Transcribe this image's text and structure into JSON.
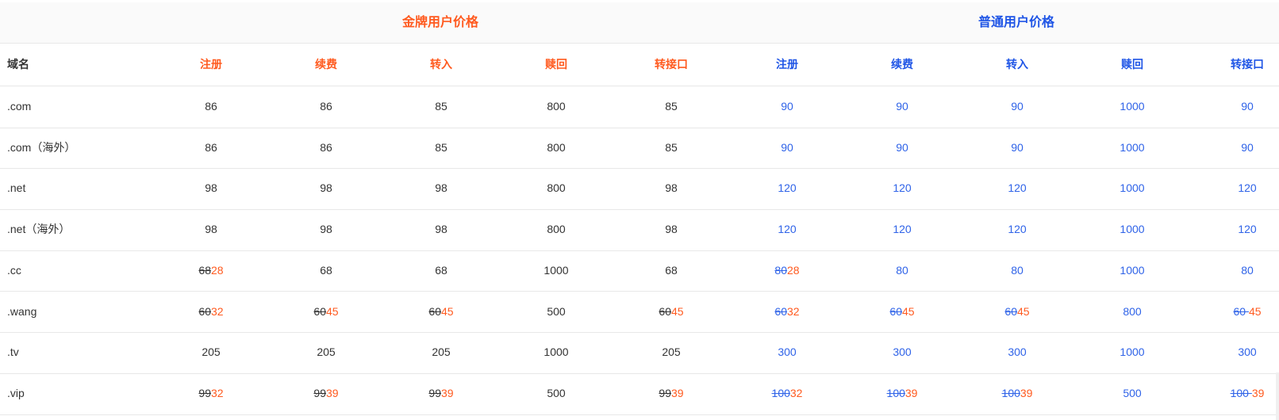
{
  "headers": {
    "gold_group": "金牌用户价格",
    "normal_group": "普通用户价格",
    "domain": "域名",
    "gold": [
      "注册",
      "续费",
      "转入",
      "赎回",
      "转接口"
    ],
    "normal": [
      "注册",
      "续费",
      "转入",
      "赎回",
      "转接口"
    ]
  },
  "rows": [
    {
      "domain": ".com",
      "gold": [
        {
          "value": "86"
        },
        {
          "value": "86"
        },
        {
          "value": "85"
        },
        {
          "value": "800"
        },
        {
          "value": "85"
        }
      ],
      "normal": [
        {
          "value": "90"
        },
        {
          "value": "90"
        },
        {
          "value": "90"
        },
        {
          "value": "1000"
        },
        {
          "value": "90"
        }
      ]
    },
    {
      "domain": ".com（海外）",
      "gold": [
        {
          "value": "86"
        },
        {
          "value": "86"
        },
        {
          "value": "85"
        },
        {
          "value": "800"
        },
        {
          "value": "85"
        }
      ],
      "normal": [
        {
          "value": "90"
        },
        {
          "value": "90"
        },
        {
          "value": "90"
        },
        {
          "value": "1000"
        },
        {
          "value": "90"
        }
      ]
    },
    {
      "domain": ".net",
      "gold": [
        {
          "value": "98"
        },
        {
          "value": "98"
        },
        {
          "value": "98"
        },
        {
          "value": "800"
        },
        {
          "value": "98"
        }
      ],
      "normal": [
        {
          "value": "120"
        },
        {
          "value": "120"
        },
        {
          "value": "120"
        },
        {
          "value": "1000"
        },
        {
          "value": "120"
        }
      ]
    },
    {
      "domain": ".net（海外）",
      "gold": [
        {
          "value": "98"
        },
        {
          "value": "98"
        },
        {
          "value": "98"
        },
        {
          "value": "800"
        },
        {
          "value": "98"
        }
      ],
      "normal": [
        {
          "value": "120"
        },
        {
          "value": "120"
        },
        {
          "value": "120"
        },
        {
          "value": "1000"
        },
        {
          "value": "120"
        }
      ]
    },
    {
      "domain": ".cc",
      "gold": [
        {
          "old": "68",
          "value": "28"
        },
        {
          "value": "68"
        },
        {
          "value": "68"
        },
        {
          "value": "1000"
        },
        {
          "value": "68"
        }
      ],
      "normal": [
        {
          "old": "80",
          "value": "28"
        },
        {
          "value": "80"
        },
        {
          "value": "80"
        },
        {
          "value": "1000"
        },
        {
          "value": "80"
        }
      ]
    },
    {
      "domain": ".wang",
      "gold": [
        {
          "old": "60",
          "value": "32"
        },
        {
          "old": "60",
          "value": "45"
        },
        {
          "old": "60",
          "value": "45"
        },
        {
          "value": "500"
        },
        {
          "old": "60",
          "value": "45"
        }
      ],
      "normal": [
        {
          "old": "60",
          "value": "32"
        },
        {
          "old": "60",
          "value": "45"
        },
        {
          "old": "60",
          "value": "45"
        },
        {
          "value": "800"
        },
        {
          "old": "60 ",
          "value": "45"
        }
      ]
    },
    {
      "domain": ".tv",
      "gold": [
        {
          "value": "205"
        },
        {
          "value": "205"
        },
        {
          "value": "205"
        },
        {
          "value": "1000"
        },
        {
          "value": "205"
        }
      ],
      "normal": [
        {
          "value": "300"
        },
        {
          "value": "300"
        },
        {
          "value": "300"
        },
        {
          "value": "1000"
        },
        {
          "value": "300"
        }
      ]
    },
    {
      "domain": ".vip",
      "gold": [
        {
          "old": "99",
          "value": "32"
        },
        {
          "old": "99",
          "value": "39"
        },
        {
          "old": "99",
          "value": "39"
        },
        {
          "value": "500"
        },
        {
          "old": "99",
          "value": "39"
        }
      ],
      "normal": [
        {
          "old": "100",
          "value": "32"
        },
        {
          "old": "100",
          "value": "39"
        },
        {
          "old": "100",
          "value": "39"
        },
        {
          "value": "500"
        },
        {
          "old": "100 ",
          "value": "39"
        }
      ]
    }
  ],
  "colors": {
    "gold_accent": "#ff5a1f",
    "normal_accent": "#1f55e6",
    "text": "#333333",
    "header_bg": "#fafafa",
    "border": "#e8e8e8"
  }
}
